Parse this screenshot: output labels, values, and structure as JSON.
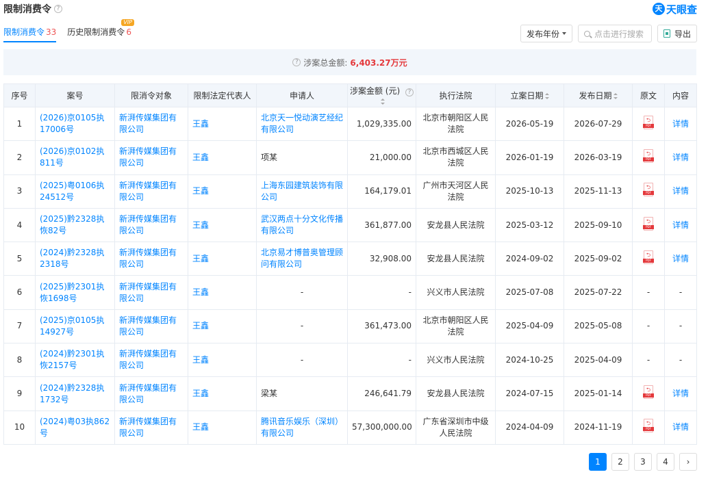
{
  "header": {
    "title": "限制消费令",
    "help_icon": "question-circle-icon"
  },
  "brand": {
    "name": "天眼查",
    "logo_glyph": "天"
  },
  "tabs": [
    {
      "label": "限制消费令",
      "count": "33",
      "active": true
    },
    {
      "label": "历史限制消费令",
      "count": "6",
      "badge": "VIP"
    }
  ],
  "toolbar": {
    "year_label": "发布年份",
    "search_placeholder": "点击进行搜索",
    "export_label": "导出"
  },
  "summary": {
    "label": "涉案总金额:",
    "amount": "6,403.27万元"
  },
  "columns": [
    "序号",
    "案号",
    "限消令对象",
    "限制法定代表人",
    "申请人",
    "涉案金额 (元)",
    "执行法院",
    "立案日期",
    "发布日期",
    "原文",
    "内容"
  ],
  "rows": [
    {
      "no": "1",
      "case": "(2026)京0105执17006号",
      "target": "新湃传媒集团有限公司",
      "rep": "王鑫",
      "applicant": "北京天一悦动演艺经纪有限公司",
      "applicant_link": true,
      "amount": "1,029,335.00",
      "court": "北京市朝阳区人民法院",
      "filed": "2026-05-19",
      "published": "2026-07-29",
      "has_pdf": true,
      "detail": "详情"
    },
    {
      "no": "2",
      "case": "(2026)京0102执811号",
      "target": "新湃传媒集团有限公司",
      "rep": "王鑫",
      "applicant": "项某",
      "applicant_link": false,
      "amount": "21,000.00",
      "court": "北京市西城区人民法院",
      "filed": "2026-01-19",
      "published": "2026-03-19",
      "has_pdf": true,
      "detail": "详情"
    },
    {
      "no": "3",
      "case": "(2025)粤0106执24512号",
      "target": "新湃传媒集团有限公司",
      "rep": "王鑫",
      "applicant": "上海东园建筑装饰有限公司",
      "applicant_link": true,
      "amount": "164,179.01",
      "court": "广州市天河区人民法院",
      "filed": "2025-10-13",
      "published": "2025-11-13",
      "has_pdf": true,
      "detail": "详情"
    },
    {
      "no": "4",
      "case": "(2025)黔2328执恢82号",
      "target": "新湃传媒集团有限公司",
      "rep": "王鑫",
      "applicant": "武汉两点十分文化传播有限公司",
      "applicant_link": true,
      "amount": "361,877.00",
      "court": "安龙县人民法院",
      "filed": "2025-03-12",
      "published": "2025-09-10",
      "has_pdf": true,
      "detail": "详情"
    },
    {
      "no": "5",
      "case": "(2024)黔2328执2318号",
      "target": "新湃传媒集团有限公司",
      "rep": "王鑫",
      "applicant": "北京易才博普奥管理顾问有限公司",
      "applicant_link": true,
      "amount": "32,908.00",
      "court": "安龙县人民法院",
      "filed": "2024-09-02",
      "published": "2025-09-02",
      "has_pdf": true,
      "detail": "详情"
    },
    {
      "no": "6",
      "case": "(2025)黔2301执恢1698号",
      "target": "新湃传媒集团有限公司",
      "rep": "王鑫",
      "applicant": "-",
      "applicant_link": false,
      "amount": "-",
      "court": "兴义市人民法院",
      "filed": "2025-07-08",
      "published": "2025-07-22",
      "has_pdf": false,
      "detail": "-"
    },
    {
      "no": "7",
      "case": "(2025)京0105执14927号",
      "target": "新湃传媒集团有限公司",
      "rep": "王鑫",
      "applicant": "-",
      "applicant_link": false,
      "amount": "361,473.00",
      "court": "北京市朝阳区人民法院",
      "filed": "2025-04-09",
      "published": "2025-05-08",
      "has_pdf": false,
      "detail": "-"
    },
    {
      "no": "8",
      "case": "(2024)黔2301执恢2157号",
      "target": "新湃传媒集团有限公司",
      "rep": "王鑫",
      "applicant": "-",
      "applicant_link": false,
      "amount": "-",
      "court": "兴义市人民法院",
      "filed": "2024-10-25",
      "published": "2025-04-09",
      "has_pdf": false,
      "detail": "-"
    },
    {
      "no": "9",
      "case": "(2024)黔2328执1732号",
      "target": "新湃传媒集团有限公司",
      "rep": "王鑫",
      "applicant": "梁某",
      "applicant_link": false,
      "amount": "246,641.79",
      "court": "安龙县人民法院",
      "filed": "2024-07-15",
      "published": "2025-01-14",
      "has_pdf": true,
      "detail": "详情"
    },
    {
      "no": "10",
      "case": "(2024)粤03执862号",
      "target": "新湃传媒集团有限公司",
      "rep": "王鑫",
      "applicant": "腾讯音乐娱乐（深圳）有限公司",
      "applicant_link": true,
      "amount": "57,300,000.00",
      "court": "广东省深圳市中级人民法院",
      "filed": "2024-04-09",
      "published": "2024-11-19",
      "has_pdf": true,
      "detail": "详情"
    }
  ],
  "pdf_label": "PDF",
  "pagination": {
    "pages": [
      "1",
      "2",
      "3",
      "4"
    ],
    "current": "1",
    "next_glyph": "›"
  }
}
